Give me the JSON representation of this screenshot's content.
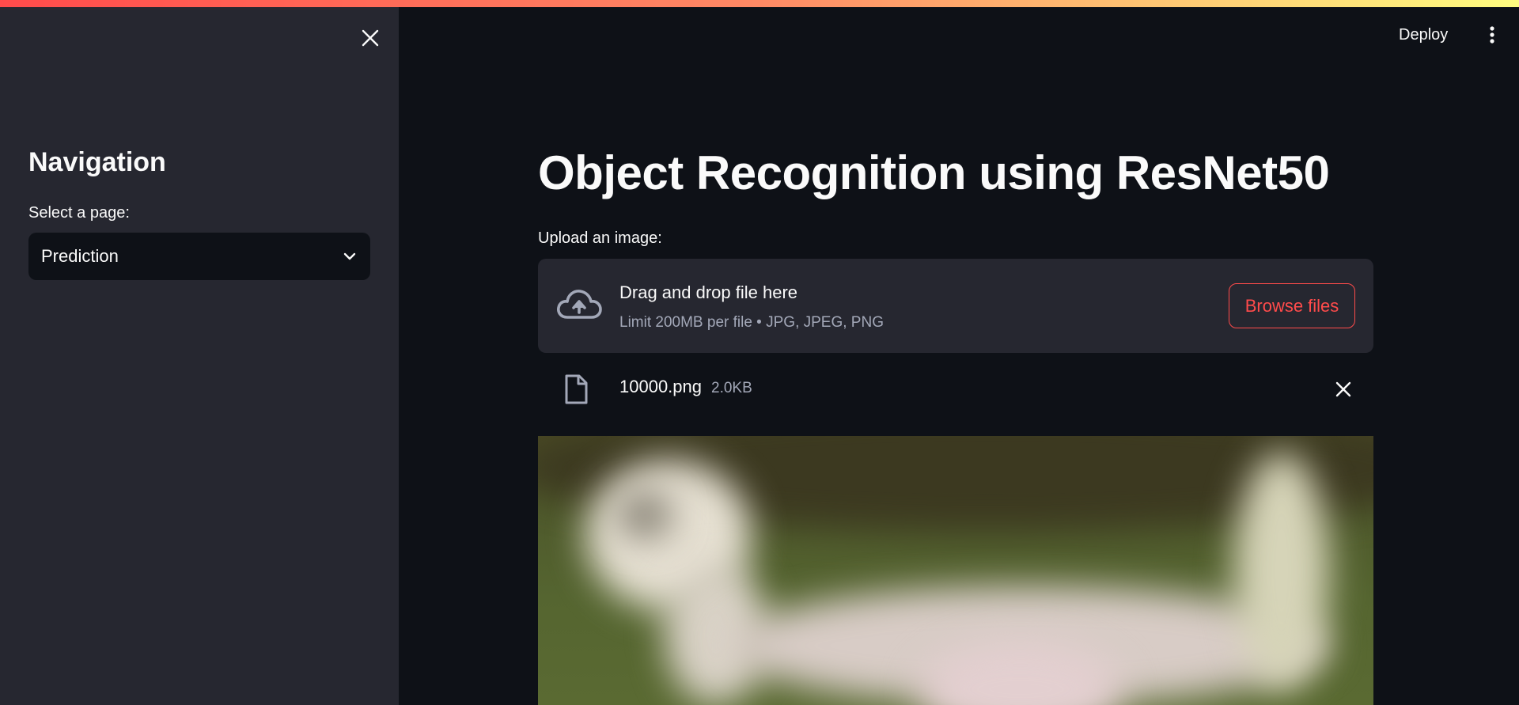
{
  "sidebar": {
    "title": "Navigation",
    "select_label": "Select a page:",
    "select_value": "Prediction"
  },
  "header": {
    "deploy_label": "Deploy"
  },
  "main": {
    "title": "Object Recognition using ResNet50",
    "upload_label": "Upload an image:",
    "dropzone": {
      "title": "Drag and drop file here",
      "subtitle": "Limit 200MB per file • JPG, JPEG, PNG",
      "browse_label": "Browse files"
    },
    "file": {
      "name": "10000.png",
      "size": "2.0KB"
    }
  },
  "colors": {
    "background": "#0e1117",
    "sidebar": "#262730",
    "accent": "#ff4b4b",
    "muted_text": "#a3a8b8"
  },
  "icons": [
    "close-icon",
    "chevron-down-icon",
    "more-vertical-icon",
    "cloud-upload-icon",
    "file-icon",
    "remove-file-icon"
  ]
}
